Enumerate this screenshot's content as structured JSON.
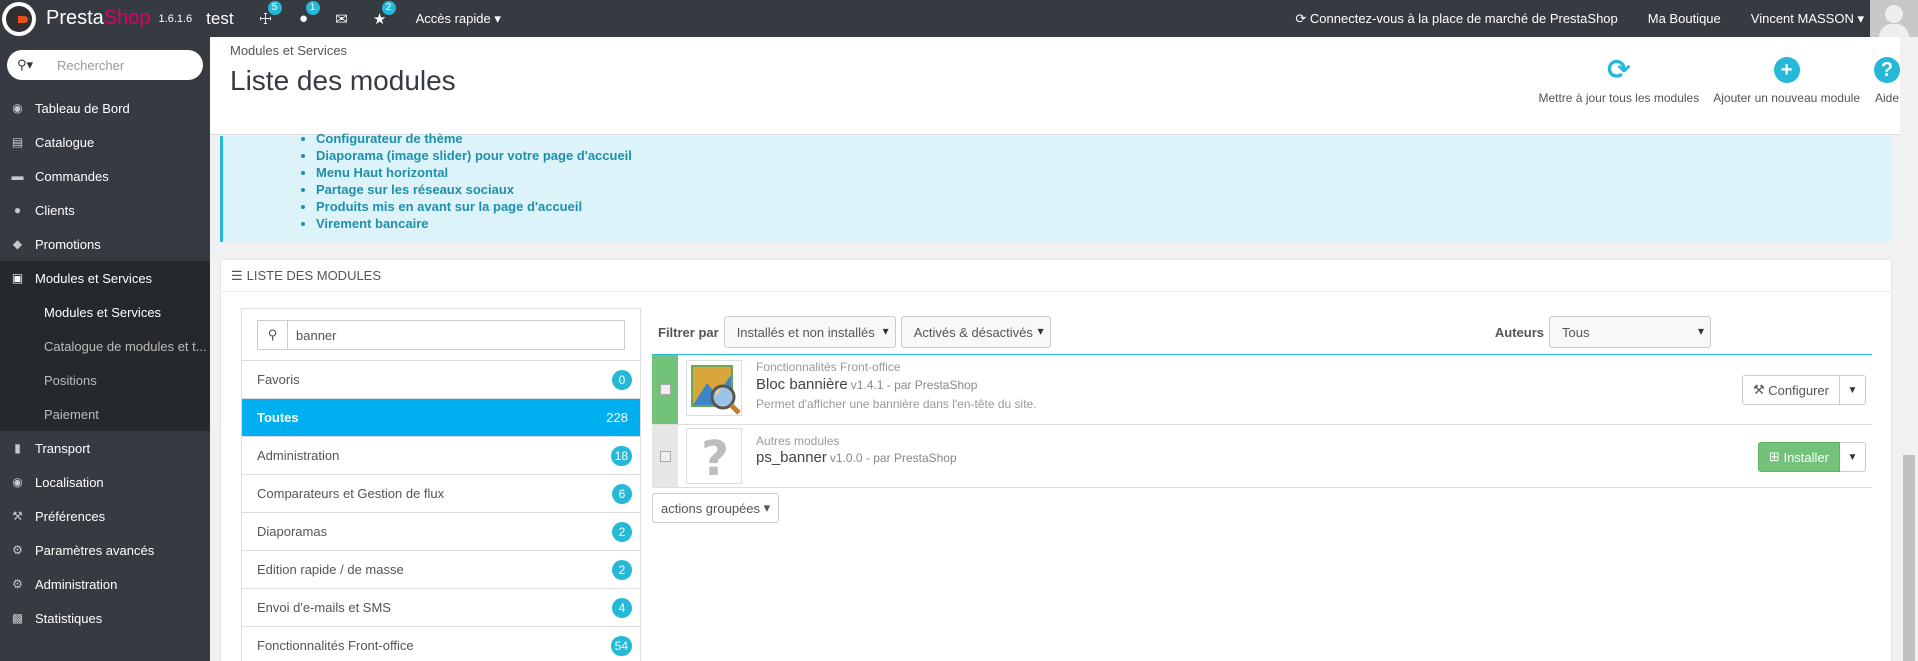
{
  "topbar": {
    "brand_part1": "Presta",
    "brand_part2": "Shop",
    "version": "1.6.1.6",
    "shop_name": "test",
    "icons": [
      {
        "name": "cart-icon",
        "glyph": "🛒",
        "badge": "5"
      },
      {
        "name": "user-icon",
        "glyph": "☺",
        "badge": "1"
      },
      {
        "name": "envelope-icon",
        "glyph": "✉",
        "badge": ""
      },
      {
        "name": "trophy-icon",
        "glyph": "🏆",
        "badge": "2"
      }
    ],
    "quick_access": "Accès rapide",
    "marketplace_link": "Connectez-vous à la place de marché de PrestaShop",
    "my_shop": "Ma Boutique",
    "user_name": "Vincent MASSON"
  },
  "sidebar": {
    "search_placeholder": "Rechercher",
    "items": [
      {
        "label": "Tableau de Bord",
        "icon": "dashboard-icon"
      },
      {
        "label": "Catalogue",
        "icon": "book-icon"
      },
      {
        "label": "Commandes",
        "icon": "credit-card-icon"
      },
      {
        "label": "Clients",
        "icon": "users-icon"
      },
      {
        "label": "Promotions",
        "icon": "tag-icon"
      },
      {
        "label": "Modules et Services",
        "icon": "puzzle-icon"
      }
    ],
    "subitems": [
      {
        "label": "Modules et Services"
      },
      {
        "label": "Catalogue de modules et t..."
      },
      {
        "label": "Positions"
      },
      {
        "label": "Paiement"
      }
    ],
    "items_after": [
      {
        "label": "Transport",
        "icon": "truck-icon"
      },
      {
        "label": "Localisation",
        "icon": "globe-icon"
      },
      {
        "label": "Préférences",
        "icon": "wrench-icon"
      },
      {
        "label": "Paramètres avancés",
        "icon": "cogs-icon"
      },
      {
        "label": "Administration",
        "icon": "cog-icon"
      },
      {
        "label": "Statistiques",
        "icon": "bar-chart-icon"
      }
    ]
  },
  "header": {
    "breadcrumb": "Modules et Services",
    "title": "Liste des modules",
    "toolbar": [
      {
        "label": "Mettre à jour tous les modules",
        "icon": "refresh-icon"
      },
      {
        "label": "Ajouter un nouveau module",
        "icon": "plus-circle-icon"
      },
      {
        "label": "Aide",
        "icon": "question-circle-icon"
      }
    ]
  },
  "alert": {
    "items": [
      "Configurateur de thème",
      "Diaporama (image slider) pour votre page d'accueil",
      "Menu Haut horizontal",
      "Partage sur les réseaux sociaux",
      "Produits mis en avant sur la page d'accueil",
      "Virement bancaire"
    ]
  },
  "panel": {
    "heading": "LISTE DES MODULES",
    "search_value": "banner",
    "categories": [
      {
        "label": "Favoris",
        "count": "0"
      },
      {
        "label": "Toutes",
        "count": "228"
      },
      {
        "label": "Administration",
        "count": "18"
      },
      {
        "label": "Comparateurs et Gestion de flux",
        "count": "6"
      },
      {
        "label": "Diaporamas",
        "count": "2"
      },
      {
        "label": "Edition rapide / de masse",
        "count": "2"
      },
      {
        "label": "Envoi d'e-mails et SMS",
        "count": "4"
      },
      {
        "label": "Fonctionnalités Front-office",
        "count": "54"
      }
    ],
    "filter_label": "Filtrer par",
    "filter_install": "Installés et non installés",
    "filter_status": "Activés & désactivés",
    "authors_label": "Auteurs",
    "authors_value": "Tous",
    "modules": [
      {
        "category": "Fonctionnalités Front-office",
        "name": "Bloc bannière",
        "version": "v1.4.1 - par PrestaShop",
        "description": "Permet d'afficher une bannière dans l'en-tête du site.",
        "action": "Configurer",
        "status_color": "#72c279"
      },
      {
        "category": "Autres modules",
        "name": "ps_banner",
        "version": "v1.0.0 - par PrestaShop",
        "description": "",
        "action": "Installer",
        "status_color": "#e6e6e6"
      }
    ],
    "grouped_actions": "actions groupées"
  },
  "colors": {
    "accent": "#25b9d7",
    "brand": "#df0067",
    "dark": "#363a41",
    "selected": "#00aff0",
    "install_green": "#72c279"
  }
}
